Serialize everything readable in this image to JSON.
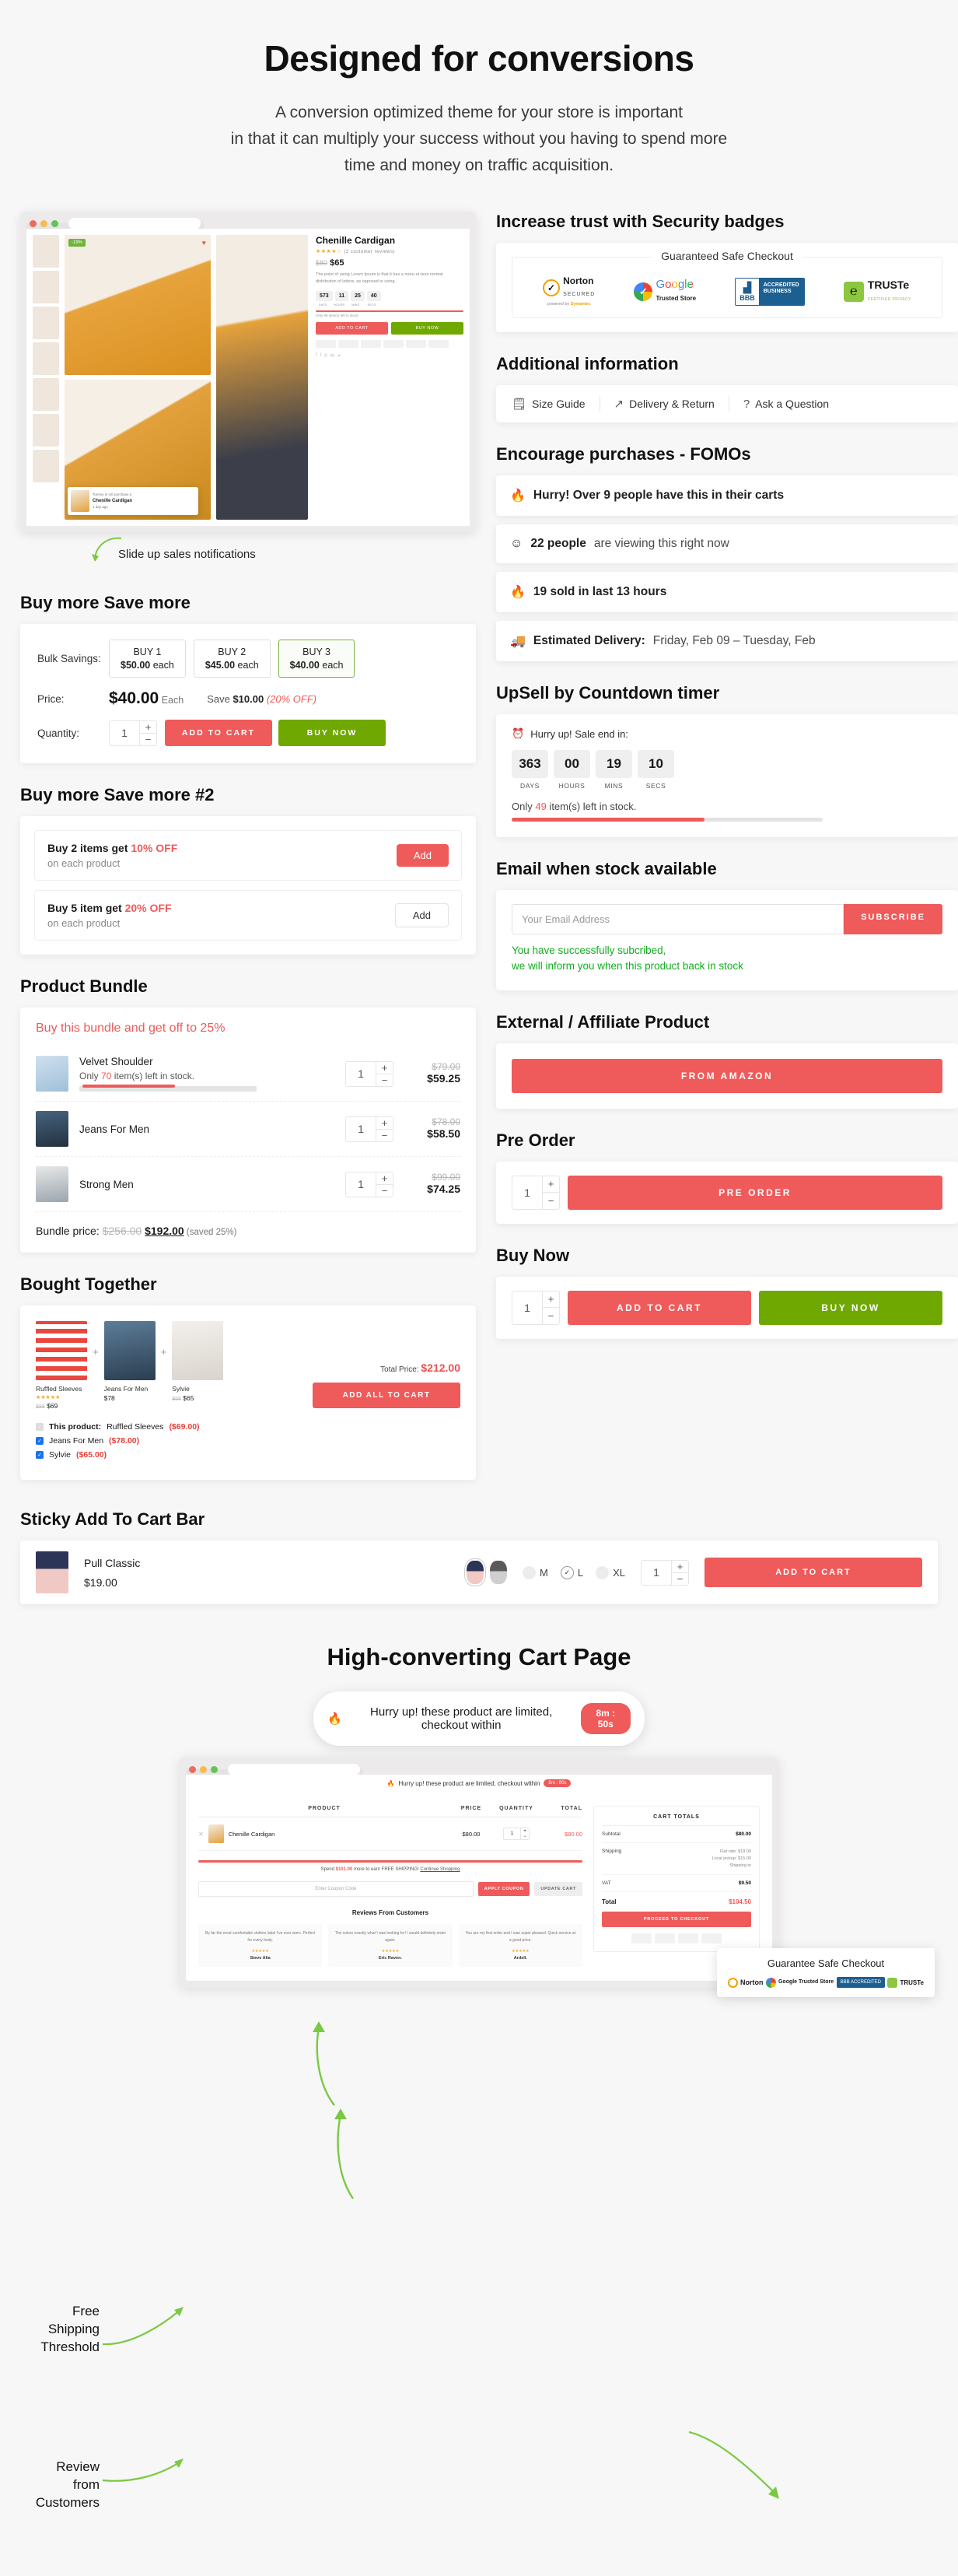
{
  "hero": {
    "title": "Designed for conversions",
    "line1": "A conversion optimized theme for your store is important",
    "line2": "in that it can multiply your success without you having to spend more",
    "line3": "time and money on traffic acquisition."
  },
  "browser_mock": {
    "product_title": "Chenille Cardigan",
    "reviews": "(2 customer reviews)",
    "old_price": "$80",
    "price": "$65",
    "description": "The point of using Lorem Ipsum is that it has a more-or-less normal distribution of letters, as opposed to using.",
    "sale_badge": "-19%",
    "countdown": [
      "573",
      "11",
      "25",
      "40"
    ],
    "countdown_labels": [
      "DAYS",
      "HOURS",
      "MINS",
      "SECS"
    ],
    "stock_text": "Only 99 item(s) left in stock.",
    "add_to_cart": "ADD TO CART",
    "buy_now": "BUY NOW",
    "popup_title": "Chenille Cardigan",
    "popup_meta": "Tommy in US purchase a",
    "popup_time": "1 day ago",
    "annotation": "Slide up sales notifications"
  },
  "security": {
    "heading": "Increase trust with Security badges",
    "caption": "Guaranteed Safe Checkout",
    "badges": [
      {
        "name": "Norton",
        "sub": "SECURED",
        "foot_a": "powered by ",
        "foot_b": "Symantec"
      },
      {
        "name": "Google",
        "sub": "Trusted Store"
      },
      {
        "name": "BBB",
        "sub_a": "ACCREDITED",
        "sub_b": "BUSINESS"
      },
      {
        "name": "TRUSTe",
        "sub": "CERTIFIED PRIVACY"
      }
    ]
  },
  "additional_info": {
    "heading": "Additional information",
    "items": [
      {
        "icon": "clipboard-icon",
        "label": "Size Guide"
      },
      {
        "icon": "share-icon",
        "label": "Delivery & Return"
      },
      {
        "icon": "question-icon",
        "label": "Ask a Question"
      }
    ]
  },
  "fomo": {
    "heading": "Encourage purchases - FOMOs",
    "items": [
      {
        "icon": "fire-icon",
        "strong": "Hurry! Over 9 people have this in their carts",
        "soft": ""
      },
      {
        "icon": "smiley-icon",
        "strong": "22 people",
        "soft": " are viewing this right now"
      },
      {
        "icon": "fire-icon",
        "strong": "19 sold in last 13 hours",
        "soft": ""
      },
      {
        "icon": "truck-icon",
        "strong": "Estimated Delivery:",
        "soft": " Friday, Feb 09 – Tuesday, Feb"
      }
    ]
  },
  "countdown_section": {
    "heading": "UpSell by Countdown timer",
    "hurry_label": "Hurry up! Sale end in:",
    "units": [
      {
        "value": "363",
        "label": "DAYS"
      },
      {
        "value": "00",
        "label": "HOURS"
      },
      {
        "value": "19",
        "label": "MINS"
      },
      {
        "value": "10",
        "label": "SECS"
      }
    ],
    "stock_prefix": "Only ",
    "stock_count": "49",
    "stock_suffix": " item(s) left in stock.",
    "stock_percent": 62
  },
  "email_stock": {
    "heading": "Email when stock available",
    "placeholder": "Your Email Address",
    "value": "",
    "subscribe_label": "SUBSCRIBE",
    "success_line1": "You have successfully subcribed,",
    "success_line2": "we will inform you when this product back in stock"
  },
  "external": {
    "heading": "External / Affiliate Product",
    "button": "FROM AMAZON"
  },
  "preorder": {
    "heading": "Pre Order",
    "qty": "1",
    "button": "PRE ORDER"
  },
  "buynow": {
    "heading": "Buy Now",
    "qty": "1",
    "add_to_cart": "ADD TO CART",
    "buy_now": "BUY NOW"
  },
  "bulk": {
    "heading": "Buy more Save more",
    "label_bulk": "Bulk Savings:",
    "options": [
      {
        "tier": "BUY 1",
        "price": "$50.00",
        "each": " each",
        "active": false
      },
      {
        "tier": "BUY 2",
        "price": "$45.00",
        "each": " each",
        "active": false
      },
      {
        "tier": "BUY 3",
        "price": "$40.00",
        "each": " each",
        "active": true
      }
    ],
    "label_price": "Price:",
    "price": "$40.00",
    "price_each": " Each",
    "save_prefix": "Save ",
    "save_amount": "$10.00",
    "save_pct": " (20% OFF)",
    "label_qty": "Quantity:",
    "qty": "1",
    "add_to_cart": "ADD TO CART",
    "buy_now": "BUY NOW"
  },
  "tiers": {
    "heading": "Buy more Save more #2",
    "offers": [
      {
        "t_prefix": "Buy 2 items get ",
        "t_pct": "10% OFF",
        "sub": "on each product",
        "button": "Add",
        "primary": true
      },
      {
        "t_prefix": "Buy 5 item get ",
        "t_pct": "20% OFF",
        "sub": "on each product",
        "button": "Add",
        "primary": false
      }
    ]
  },
  "bundle": {
    "heading": "Product Bundle",
    "promo": "Buy this bundle and get off to 25%",
    "items": [
      {
        "name": "Velvet Shoulder",
        "stock_prefix": "Only ",
        "stock_count": "70",
        "stock_suffix": " item(s) left in stock.",
        "stock_percent": 54,
        "qty": "1",
        "old": "$79.00",
        "new": "$59.25"
      },
      {
        "name": "Jeans For Men",
        "stock_prefix": "",
        "stock_count": "",
        "stock_suffix": "",
        "stock_percent": 0,
        "qty": "1",
        "old": "$78.00",
        "new": "$58.50"
      },
      {
        "name": "Strong Men",
        "stock_prefix": "",
        "stock_count": "",
        "stock_suffix": "",
        "stock_percent": 0,
        "qty": "1",
        "old": "$99.00",
        "new": "$74.25"
      }
    ],
    "total_label": "Bundle price: ",
    "total_old": "$256.00",
    "total_new": "$192.00",
    "total_saved": " (saved 25%)"
  },
  "bought_together": {
    "heading": "Bought Together",
    "products": [
      {
        "name": "Ruffled Sleeves",
        "stars": "★★★★★",
        "old": "$88",
        "price": "$69"
      },
      {
        "name": "Jeans For Men",
        "stars": "",
        "old": "",
        "price": "$78"
      },
      {
        "name": "Sylvie",
        "stars": "",
        "old": "$69",
        "price": "$65"
      }
    ],
    "checks": [
      {
        "prefix": "This product: ",
        "name": "Ruffled Sleeves",
        "price": "($69.00)",
        "checked": false
      },
      {
        "prefix": "",
        "name": "Jeans For Men",
        "price": "($78.00)",
        "checked": true
      },
      {
        "prefix": "",
        "name": "Sylvie",
        "price": "($65.00)",
        "checked": true
      }
    ],
    "total_label": "Total Price: ",
    "total_price": "$212.00",
    "add_all": "ADD ALL TO CART"
  },
  "sticky": {
    "heading": "Sticky Add To Cart Bar",
    "product": "Pull Classic",
    "price": "$19.00",
    "sizes": [
      {
        "label": "M",
        "selected": false
      },
      {
        "label": "L",
        "selected": true
      },
      {
        "label": "XL",
        "selected": false
      }
    ],
    "qty": "1",
    "add_to_cart": "ADD TO CART"
  },
  "cart_page": {
    "heading": "High-converting Cart Page",
    "hurry_text": "Hurry up! these product are limited, checkout within",
    "hurry_timer": "8m : 50s",
    "mock_banner": "Hurry up! these product are limited, checkout within",
    "mock_timer": "8m : 80s",
    "table_headers": [
      "PRODUCT",
      "PRICE",
      "QUANTITY",
      "TOTAL"
    ],
    "row": {
      "name": "Chenille Cardigan",
      "price": "$80.00",
      "qty": "1",
      "total": "$80.00"
    },
    "free_ship_prefix": "Spend ",
    "free_ship_amount": "$101.00",
    "free_ship_mid": " more to earn FREE SHIPPING! ",
    "free_ship_link": "Continue Shopping",
    "coupon_placeholder": "Enter Coupon Code",
    "apply_coupon": "APPLY COUPON",
    "update_cart": "UPDATE CART",
    "reviews_heading": "Reviews From Customers",
    "reviews": [
      {
        "text": "By far the most comfortable clothes label I've ever worn. Perfect for every body.",
        "stars": "★★★★★",
        "name": "Steve Alia"
      },
      {
        "text": "The colors exactly what I was looking for! I would definitely order again.",
        "stars": "★★★★★",
        "name": "Eric Raven."
      },
      {
        "text": "You are my first order and I was super pleased. Quick service at a good price.",
        "stars": "★★★★★",
        "name": "Ardell."
      }
    ],
    "totals_title": "CART TOTALS",
    "totals": [
      {
        "label": "Subtotal",
        "value": "$80.00",
        "note": ""
      },
      {
        "label": "Shipping",
        "value": "",
        "note": "Flat rate: $19.00\nLocal pickup: $15.00\nShipping to"
      },
      {
        "label": "VAT",
        "value": "$9.50",
        "note": ""
      }
    ],
    "total_label": "Total",
    "total_value": "$104.50",
    "proceed": "PROCEED TO CHECKOUT"
  },
  "guarantee": {
    "title": "Guarantee Safe Checkout",
    "badges": [
      "Norton",
      "Google Trusted Store",
      "BBB ACCREDITED",
      "TRUSTe"
    ]
  },
  "annotations": {
    "free_shipping": "Free\nShipping\nThreshold",
    "reviews": "Review\nfrom\nCustomers"
  },
  "colors": {
    "accent_red": "#ef5a5a",
    "green": "#6fa800",
    "success": "#12ad1f",
    "page_bg": "#f7f7f7"
  }
}
